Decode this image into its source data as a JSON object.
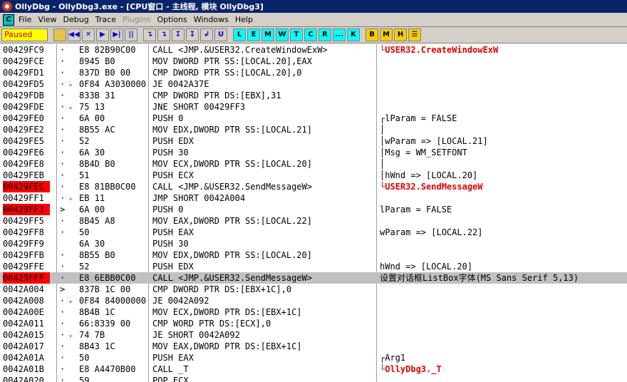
{
  "window": {
    "title": "OllyDbg - OllyDbg3.exe - [CPU窗口 - 主线程, 模块 OllyDbg3]"
  },
  "menu": [
    "File",
    "View",
    "Debug",
    "Trace",
    "Plugins",
    "Options",
    "Windows",
    "Help"
  ],
  "menu_disabled": [
    "Plugins"
  ],
  "status": "Paused",
  "toolbar": {
    "nav": [
      "◀◀",
      "✕",
      "▶",
      "▶|",
      "||"
    ],
    "step": [
      "↴",
      "↴",
      "↧",
      "↧",
      "↲",
      "U"
    ],
    "windows": [
      "L",
      "E",
      "M",
      "W",
      "T",
      "C",
      "R",
      "...",
      "K"
    ],
    "extra": [
      "B",
      "M",
      "H",
      "☰"
    ]
  },
  "rows": [
    {
      "addr": "00429FC9",
      "mark": "·",
      "jmp": "",
      "hex": "E8 82B90C00",
      "dis": "CALL <JMP.&USER32.CreateWindowExW>",
      "cmt": "└USER32.CreateWindowExW",
      "red": true,
      "bp": false,
      "sel": false
    },
    {
      "addr": "00429FCE",
      "mark": "·",
      "jmp": "",
      "hex": "8945 B0",
      "dis": "MOV DWORD PTR SS:[LOCAL.20],EAX",
      "cmt": "",
      "red": false,
      "bp": false,
      "sel": false
    },
    {
      "addr": "00429FD1",
      "mark": "·",
      "jmp": "",
      "hex": "837D B0 00",
      "dis": "CMP DWORD PTR SS:[LOCAL.20],0",
      "cmt": "",
      "red": false,
      "bp": false,
      "sel": false
    },
    {
      "addr": "00429FD5",
      "mark": "·",
      "jmp": "⌄",
      "hex": "0F84 A3030000",
      "dis": "JE 0042A37E",
      "cmt": "",
      "red": false,
      "bp": false,
      "sel": false
    },
    {
      "addr": "00429FDB",
      "mark": "·",
      "jmp": "",
      "hex": "833B 31",
      "dis": "CMP DWORD PTR DS:[EBX],31",
      "cmt": "",
      "red": false,
      "bp": false,
      "sel": false
    },
    {
      "addr": "00429FDE",
      "mark": "·",
      "jmp": "⌄",
      "hex": "75 13",
      "dis": "JNE SHORT 00429FF3",
      "cmt": "",
      "red": false,
      "bp": false,
      "sel": false
    },
    {
      "addr": "00429FE0",
      "mark": "·",
      "jmp": "",
      "hex": "6A 00",
      "dis": "PUSH 0",
      "cmt": "┌lParam = FALSE",
      "red": false,
      "bp": false,
      "sel": false
    },
    {
      "addr": "00429FE2",
      "mark": "·",
      "jmp": "",
      "hex": "8B55 AC",
      "dis": "MOV EDX,DWORD PTR SS:[LOCAL.21]",
      "cmt": "│",
      "red": false,
      "bp": false,
      "sel": false
    },
    {
      "addr": "00429FE5",
      "mark": "·",
      "jmp": "",
      "hex": "52",
      "dis": "PUSH EDX",
      "cmt": "│wParam => [LOCAL.21]",
      "red": false,
      "bp": false,
      "sel": false
    },
    {
      "addr": "00429FE6",
      "mark": "·",
      "jmp": "",
      "hex": "6A 30",
      "dis": "PUSH 30",
      "cmt": "│Msg = WM_SETFONT",
      "red": false,
      "bp": false,
      "sel": false
    },
    {
      "addr": "00429FE8",
      "mark": "·",
      "jmp": "",
      "hex": "8B4D B0",
      "dis": "MOV ECX,DWORD PTR SS:[LOCAL.20]",
      "cmt": "│",
      "red": false,
      "bp": false,
      "sel": false
    },
    {
      "addr": "00429FEB",
      "mark": "·",
      "jmp": "",
      "hex": "51",
      "dis": "PUSH ECX",
      "cmt": "│hWnd => [LOCAL.20]",
      "red": false,
      "bp": false,
      "sel": false
    },
    {
      "addr": "00429FEC",
      "mark": "·",
      "jmp": "",
      "hex": "E8 81BB0C00",
      "dis": "CALL <JMP.&USER32.SendMessageW>",
      "cmt": "└USER32.SendMessageW",
      "red": true,
      "bp": true,
      "sel": false
    },
    {
      "addr": "00429FF1",
      "mark": "·",
      "jmp": "⌄",
      "hex": "EB 11",
      "dis": "JMP SHORT 0042A004",
      "cmt": "",
      "red": false,
      "bp": false,
      "sel": false
    },
    {
      "addr": "00429FF3",
      "mark": ">",
      "jmp": "",
      "hex": "6A 00",
      "dis": "PUSH 0",
      "cmt": "lParam = FALSE",
      "red": false,
      "bp": true,
      "sel": false
    },
    {
      "addr": "00429FF5",
      "mark": "·",
      "jmp": "",
      "hex": "8B45 A8",
      "dis": "MOV EAX,DWORD PTR SS:[LOCAL.22]",
      "cmt": "",
      "red": false,
      "bp": false,
      "sel": false
    },
    {
      "addr": "00429FF8",
      "mark": "·",
      "jmp": "",
      "hex": "50",
      "dis": "PUSH EAX",
      "cmt": "wParam => [LOCAL.22]",
      "red": false,
      "bp": false,
      "sel": false
    },
    {
      "addr": "00429FF9",
      "mark": "",
      "jmp": "",
      "hex": "6A 30",
      "dis": "PUSH 30",
      "cmt": "",
      "red": false,
      "bp": false,
      "sel": false
    },
    {
      "addr": "00429FFB",
      "mark": "·",
      "jmp": "",
      "hex": "8B55 B0",
      "dis": "MOV EDX,DWORD PTR SS:[LOCAL.20]",
      "cmt": "",
      "red": false,
      "bp": false,
      "sel": false
    },
    {
      "addr": "00429FFE",
      "mark": "·",
      "jmp": "",
      "hex": "52",
      "dis": "PUSH EDX",
      "cmt": "hWnd => [LOCAL.20]",
      "red": false,
      "bp": false,
      "sel": false
    },
    {
      "addr": "00429FFF",
      "mark": "·",
      "jmp": "",
      "hex": "E8 6EBB0C00",
      "dis": "CALL <JMP.&USER32.SendMessageW>",
      "cmt": "设置对话框ListBox字体(MS Sans Serif 5,13)",
      "red": false,
      "bp": true,
      "sel": true
    },
    {
      "addr": "0042A004",
      "mark": ">",
      "jmp": "",
      "hex": "837B 1C 00",
      "dis": "CMP DWORD PTR DS:[EBX+1C],0",
      "cmt": "",
      "red": false,
      "bp": false,
      "sel": false
    },
    {
      "addr": "0042A008",
      "mark": "·",
      "jmp": "⌄",
      "hex": "0F84 84000000",
      "dis": "JE 0042A092",
      "cmt": "",
      "red": false,
      "bp": false,
      "sel": false
    },
    {
      "addr": "0042A00E",
      "mark": "·",
      "jmp": "",
      "hex": "8B4B 1C",
      "dis": "MOV ECX,DWORD PTR DS:[EBX+1C]",
      "cmt": "",
      "red": false,
      "bp": false,
      "sel": false
    },
    {
      "addr": "0042A011",
      "mark": "·",
      "jmp": "",
      "hex": "66:8339 00",
      "dis": "CMP WORD PTR DS:[ECX],0",
      "cmt": "",
      "red": false,
      "bp": false,
      "sel": false
    },
    {
      "addr": "0042A015",
      "mark": "·",
      "jmp": "⌄",
      "hex": "74 7B",
      "dis": "JE SHORT 0042A092",
      "cmt": "",
      "red": false,
      "bp": false,
      "sel": false
    },
    {
      "addr": "0042A017",
      "mark": "·",
      "jmp": "",
      "hex": "8B43 1C",
      "dis": "MOV EAX,DWORD PTR DS:[EBX+1C]",
      "cmt": "",
      "red": false,
      "bp": false,
      "sel": false
    },
    {
      "addr": "0042A01A",
      "mark": "·",
      "jmp": "",
      "hex": "50",
      "dis": "PUSH EAX",
      "cmt": "┌Arg1",
      "red": false,
      "bp": false,
      "sel": false
    },
    {
      "addr": "0042A01B",
      "mark": "·",
      "jmp": "",
      "hex": "E8 A4470B00",
      "dis": "CALL _T",
      "cmt": "└OllyDbg3._T",
      "red": true,
      "bp": false,
      "sel": false
    },
    {
      "addr": "0042A020",
      "mark": "·",
      "jmp": "",
      "hex": "59",
      "dis": "POP ECX",
      "cmt": "",
      "red": false,
      "bp": false,
      "sel": false
    }
  ]
}
